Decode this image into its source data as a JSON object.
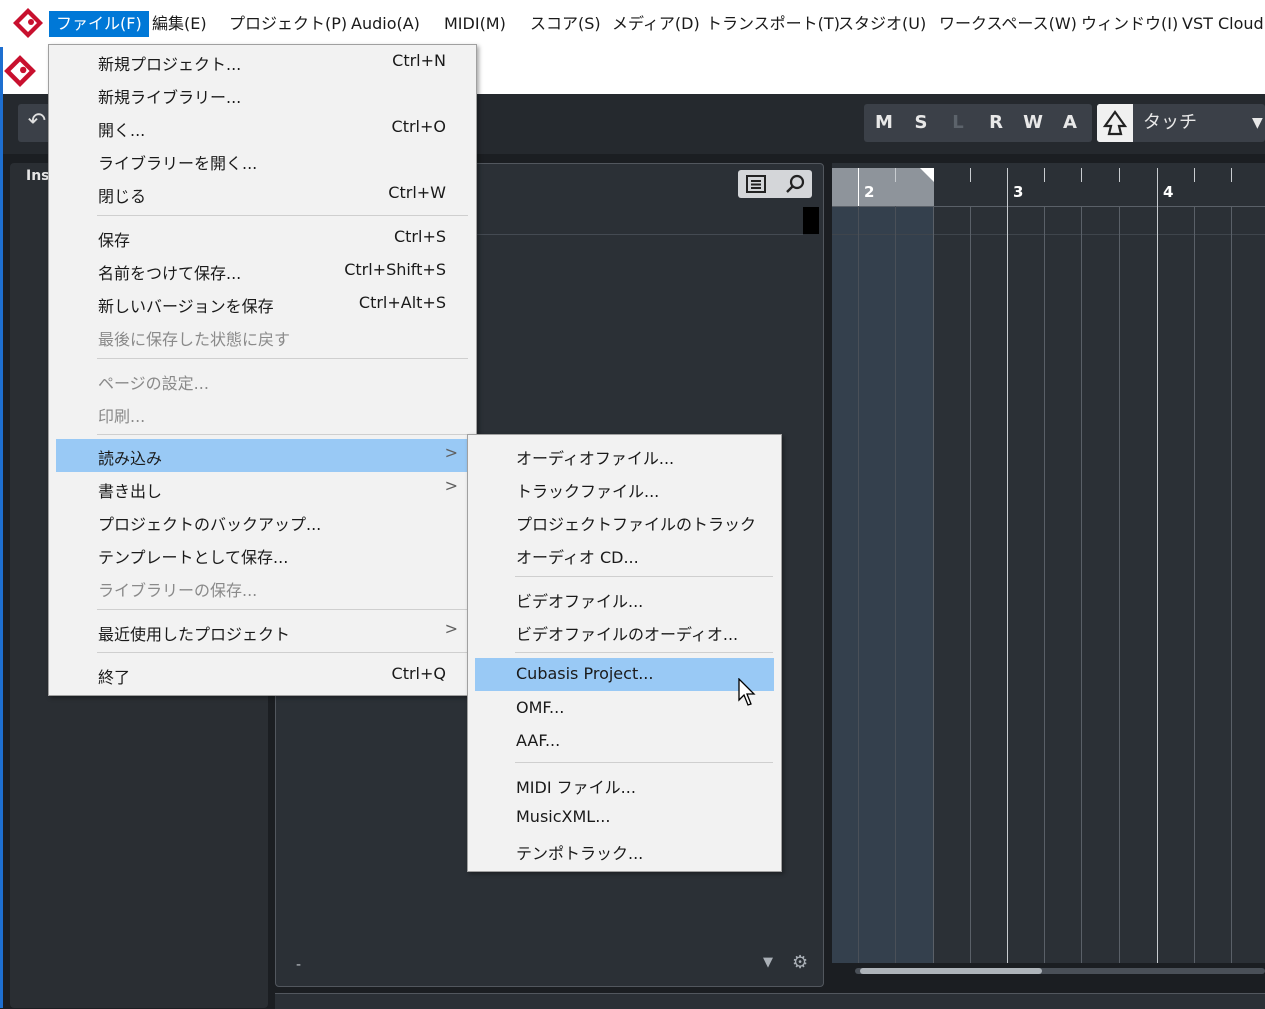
{
  "menubar": {
    "items": [
      "ファイル(F)",
      "編集(E)",
      "プロジェクト(P)",
      "Audio(A)",
      "MIDI(M)",
      "スコア(S)",
      "メディア(D)",
      "トランスポート(T)",
      "スタジオ(U)",
      "ワークスペース(W)",
      "ウィンドウ(I)",
      "VST Cloud("
    ],
    "active_index": 0
  },
  "toolbar": {
    "undo_glyph": "↶",
    "buttons": [
      "M",
      "S",
      "L",
      "R",
      "W",
      "A"
    ],
    "automation_mode": "タッチ"
  },
  "inspector": {
    "label": "Ins"
  },
  "tracklist": {
    "footer_dash": "-"
  },
  "ruler": {
    "bars": [
      "2",
      "3",
      "4"
    ]
  },
  "file_menu": {
    "items": [
      {
        "label": "新規プロジェクト...",
        "shortcut": "Ctrl+N",
        "disabled": false
      },
      {
        "label": "新規ライブラリー...",
        "shortcut": "",
        "disabled": false
      },
      {
        "label": "開く...",
        "shortcut": "Ctrl+O",
        "disabled": false
      },
      {
        "label": "ライブラリーを開く...",
        "shortcut": "",
        "disabled": false
      },
      {
        "label": "閉じる",
        "shortcut": "Ctrl+W",
        "disabled": false
      },
      {
        "label": "保存",
        "shortcut": "Ctrl+S",
        "disabled": false
      },
      {
        "label": "名前をつけて保存...",
        "shortcut": "Ctrl+Shift+S",
        "disabled": false
      },
      {
        "label": "新しいバージョンを保存",
        "shortcut": "Ctrl+Alt+S",
        "disabled": false
      },
      {
        "label": "最後に保存した状態に戻す",
        "shortcut": "",
        "disabled": true
      },
      {
        "label": "ページの設定...",
        "shortcut": "",
        "disabled": true
      },
      {
        "label": "印刷...",
        "shortcut": "",
        "disabled": true
      },
      {
        "label": "読み込み",
        "shortcut": "",
        "disabled": false,
        "submenu": true,
        "highlighted": true
      },
      {
        "label": "書き出し",
        "shortcut": "",
        "disabled": false,
        "submenu": true
      },
      {
        "label": "プロジェクトのバックアップ...",
        "shortcut": "",
        "disabled": false
      },
      {
        "label": "テンプレートとして保存...",
        "shortcut": "",
        "disabled": false
      },
      {
        "label": "ライブラリーの保存...",
        "shortcut": "",
        "disabled": true
      },
      {
        "label": "最近使用したプロジェクト",
        "shortcut": "",
        "disabled": false,
        "submenu": true
      },
      {
        "label": "終了",
        "shortcut": "Ctrl+Q",
        "disabled": false
      }
    ],
    "submenu_arrow": ">"
  },
  "import_submenu": {
    "items": [
      {
        "label": "オーディオファイル..."
      },
      {
        "label": "トラックファイル..."
      },
      {
        "label": "プロジェクトファイルのトラック"
      },
      {
        "label": "オーディオ CD..."
      },
      {
        "label": "ビデオファイル..."
      },
      {
        "label": "ビデオファイルのオーディオ..."
      },
      {
        "label": "Cubasis Project...",
        "highlighted": true
      },
      {
        "label": "OMF..."
      },
      {
        "label": "AAF..."
      },
      {
        "label": "MIDI ファイル..."
      },
      {
        "label": "MusicXML..."
      },
      {
        "label": "テンポトラック..."
      }
    ]
  },
  "colors": {
    "accent": "#0078d7",
    "menu_highlight": "#99c9f5",
    "logo_red": "#c8102e"
  }
}
